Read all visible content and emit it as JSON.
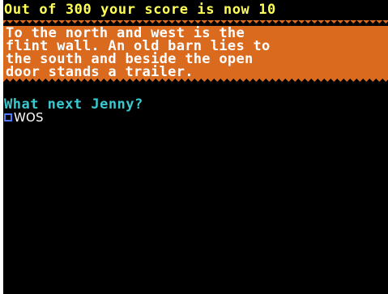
{
  "status": {
    "score_text": "Out of 300 your score is now 10"
  },
  "location": {
    "description_lines": [
      "To the north and west is the",
      "flint wall. An old barn lies to",
      "the south and beside the open",
      "door stands a trailer."
    ]
  },
  "prompt": {
    "text": "What next Jenny?"
  },
  "command_input": {
    "value": "WOS"
  },
  "colors": {
    "score": "#ffff55",
    "panel": "#d96a1e",
    "prompt": "#39c9cf",
    "cursor": "#4f7cff",
    "background": "#000000"
  }
}
